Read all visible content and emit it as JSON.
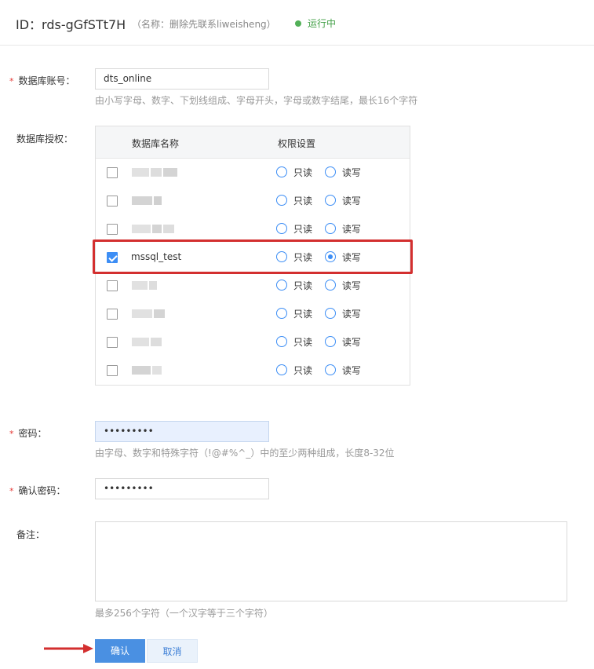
{
  "header": {
    "id_title": "ID：rds-gGfSTt7H",
    "subtitle": "（名称：删除先联系liweisheng）",
    "status": "运行中",
    "status_color": "#52b058"
  },
  "form": {
    "account": {
      "label": "数据库账号：",
      "value": "dts_online",
      "hint": "由小写字母、数字、下划线组成、字母开头，字母或数字结尾，最长16个字符"
    },
    "auth": {
      "label": "数据库授权：",
      "col_name": "数据库名称",
      "col_perm": "权限设置",
      "readonly_label": "只读",
      "readwrite_label": "读写",
      "rows": [
        {
          "name": "",
          "obscured": true,
          "checked": false,
          "perm": "none"
        },
        {
          "name": "",
          "obscured": true,
          "checked": false,
          "perm": "none"
        },
        {
          "name": "",
          "obscured": true,
          "checked": false,
          "perm": "none"
        },
        {
          "name": "mssql_test",
          "obscured": false,
          "checked": true,
          "perm": "readwrite"
        },
        {
          "name": "",
          "obscured": true,
          "checked": false,
          "perm": "none"
        },
        {
          "name": "",
          "obscured": true,
          "checked": false,
          "perm": "none"
        },
        {
          "name": "",
          "obscured": true,
          "checked": false,
          "perm": "none"
        },
        {
          "name": "",
          "obscured": true,
          "checked": false,
          "perm": "none"
        }
      ]
    },
    "password": {
      "label": "密码：",
      "value": "•••••••••",
      "hint": "由字母、数字和特殊字符（!@#%^_）中的至少两种组成，长度8-32位"
    },
    "confirm_password": {
      "label": "确认密码：",
      "value": "•••••••••"
    },
    "remark": {
      "label": "备注：",
      "hint": "最多256个字符（一个汉字等于三个字符）"
    },
    "confirm_button": "确认",
    "cancel_button": "取消"
  },
  "colors": {
    "primary": "#4a90e2",
    "annotation_red": "#d32f2f",
    "required": "#e53935"
  }
}
